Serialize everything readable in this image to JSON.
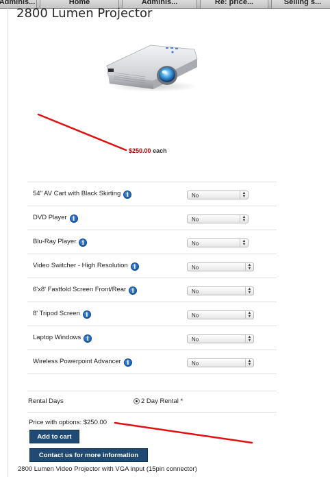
{
  "browser_tabs": [
    {
      "label": "Adminis..."
    },
    {
      "label": "Home"
    },
    {
      "label": "Adminis..."
    },
    {
      "label": "Re: price..."
    },
    {
      "label": "Selling s..."
    }
  ],
  "product": {
    "title": "2800 Lumen Projector",
    "price": "$250.00",
    "price_unit": "each",
    "description": "2800 Lumen Video Projector with VGA input (15pin connector)"
  },
  "options": [
    {
      "label": "54\" AV Cart with Black Skirting",
      "value": "No"
    },
    {
      "label": "DVD Player",
      "value": "No"
    },
    {
      "label": "Blu-Ray Player",
      "value": "No"
    },
    {
      "label": "Video Switcher - High Resolution",
      "value": "No"
    },
    {
      "label": "6'x8' Fastfold Screen Front/Rear",
      "value": "No"
    },
    {
      "label": "8' Tripod Screen",
      "value": "No"
    },
    {
      "label": "Laptop Windows",
      "value": "No"
    },
    {
      "label": "Wireless Powerpoint Advancer",
      "value": "No"
    }
  ],
  "rental": {
    "label": "Rental Days",
    "value": "2 Day Rental *"
  },
  "price_with_options": "Price with options: $250.00",
  "buttons": {
    "add_to_cart": "Add to cart",
    "contact": "Contact us for more information"
  },
  "colors": {
    "price": "#b00000",
    "button_bg": "#1e4a73",
    "annotation": "#e01010",
    "info_icon": "#1c5cb0"
  },
  "icons": {
    "info": "info-icon",
    "select_arrows": "select-arrows-icon"
  }
}
